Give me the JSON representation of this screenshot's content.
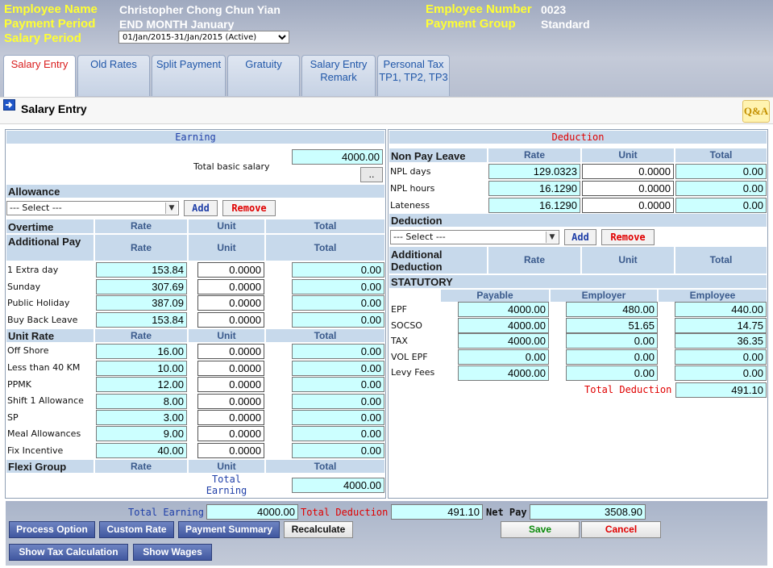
{
  "header": {
    "employee_name_label": "Employee Name",
    "employee_name": "Christopher Chong Chun Yian",
    "payment_period_label": "Payment Period",
    "payment_period": "END MONTH  January",
    "salary_period_label": "Salary Period",
    "salary_period_selected": "01/Jan/2015-31/Jan/2015 (Active)",
    "employee_number_label": "Employee Number",
    "employee_number": "0023",
    "payment_group_label": "Payment Group",
    "payment_group": "Standard"
  },
  "tabs": [
    {
      "label": "Salary Entry",
      "active": true
    },
    {
      "label": "Old Rates",
      "active": false
    },
    {
      "label": "Split Payment",
      "active": false
    },
    {
      "label": "Gratuity",
      "active": false
    },
    {
      "label": "Salary Entry Remark",
      "active": false
    },
    {
      "label": "Personal Tax TP1, TP2, TP3",
      "active": false
    }
  ],
  "page_title": "Salary Entry",
  "qa_icon_text": "Q&A",
  "earning": {
    "title": "Earning",
    "total_basic_salary_label": "Total basic salary",
    "total_basic_salary": "4000.00",
    "browse_label": "..",
    "allowance_label": "Allowance",
    "select_placeholder": "--- Select ---",
    "add_label": "Add",
    "remove_label": "Remove",
    "col_rate": "Rate",
    "col_unit": "Unit",
    "col_total": "Total",
    "overtime_label": "Overtime",
    "additional_pay_label": "Additional Pay",
    "additional_pay_rows": [
      {
        "label": "1 Extra day",
        "rate": "153.84",
        "unit": "0.0000",
        "total": "0.00"
      },
      {
        "label": "Sunday",
        "rate": "307.69",
        "unit": "0.0000",
        "total": "0.00"
      },
      {
        "label": "Public Holiday",
        "rate": "387.09",
        "unit": "0.0000",
        "total": "0.00"
      },
      {
        "label": "Buy Back Leave",
        "rate": "153.84",
        "unit": "0.0000",
        "total": "0.00"
      }
    ],
    "unit_rate_label": "Unit Rate",
    "unit_rate_rows": [
      {
        "label": "Off Shore",
        "rate": "16.00",
        "unit": "0.0000",
        "total": "0.00"
      },
      {
        "label": "Less than 40 KM",
        "rate": "10.00",
        "unit": "0.0000",
        "total": "0.00"
      },
      {
        "label": "PPMK",
        "rate": "12.00",
        "unit": "0.0000",
        "total": "0.00"
      },
      {
        "label": "Shift 1 Allowance",
        "rate": "8.00",
        "unit": "0.0000",
        "total": "0.00"
      },
      {
        "label": "SP",
        "rate": "3.00",
        "unit": "0.0000",
        "total": "0.00"
      },
      {
        "label": "Meal Allowances",
        "rate": "9.00",
        "unit": "0.0000",
        "total": "0.00"
      },
      {
        "label": "Fix Incentive",
        "rate": "40.00",
        "unit": "0.0000",
        "total": "0.00"
      }
    ],
    "flexi_group_label": "Flexi Group",
    "total_earning_label": "Total Earning",
    "total_earning": "4000.00"
  },
  "deduction": {
    "title": "Deduction",
    "non_pay_leave_label": "Non Pay Leave",
    "col_rate": "Rate",
    "col_unit": "Unit",
    "col_total": "Total",
    "npl_rows": [
      {
        "label": "NPL days",
        "rate": "129.0323",
        "unit": "0.0000",
        "total": "0.00"
      },
      {
        "label": "NPL hours",
        "rate": "16.1290",
        "unit": "0.0000",
        "total": "0.00"
      },
      {
        "label": "Lateness",
        "rate": "16.1290",
        "unit": "0.0000",
        "total": "0.00"
      }
    ],
    "deduction_label": "Deduction",
    "select_placeholder": "--- Select ---",
    "add_label": "Add",
    "remove_label": "Remove",
    "additional_deduction_label": "Additional Deduction",
    "statutory_label": "STATUTORY",
    "col_payable": "Payable",
    "col_employer": "Employer",
    "col_employee": "Employee",
    "statutory_rows": [
      {
        "label": "EPF",
        "payable": "4000.00",
        "employer": "480.00",
        "employee": "440.00"
      },
      {
        "label": "SOCSO",
        "payable": "4000.00",
        "employer": "51.65",
        "employee": "14.75"
      },
      {
        "label": "TAX",
        "payable": "4000.00",
        "employer": "0.00",
        "employee": "36.35"
      },
      {
        "label": "VOL EPF",
        "payable": "0.00",
        "employer": "0.00",
        "employee": "0.00"
      },
      {
        "label": "Levy Fees",
        "payable": "4000.00",
        "employer": "0.00",
        "employee": "0.00"
      }
    ],
    "total_deduction_label": "Total Deduction",
    "total_deduction": "491.10"
  },
  "footer": {
    "total_earning_label": "Total Earning",
    "total_earning": "4000.00",
    "total_deduction_label": "Total Deduction",
    "total_deduction": "491.10",
    "net_pay_label": "Net Pay",
    "net_pay": "3508.90",
    "process_option": "Process Option",
    "custom_rate": "Custom Rate",
    "payment_summary": "Payment Summary",
    "recalculate": "Recalculate",
    "save": "Save",
    "cancel": "Cancel",
    "show_tax_calculation": "Show Tax Calculation",
    "show_wages": "Show Wages"
  }
}
